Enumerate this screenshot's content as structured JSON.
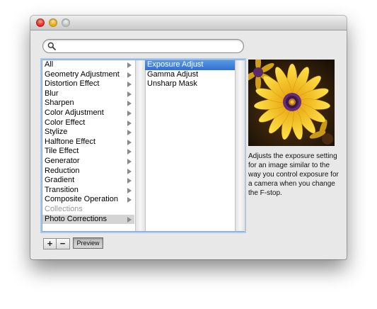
{
  "search": {
    "placeholder": "",
    "value": ""
  },
  "categories": [
    {
      "label": "All",
      "has_children": true
    },
    {
      "label": "Geometry Adjustment",
      "has_children": true
    },
    {
      "label": "Distortion Effect",
      "has_children": true
    },
    {
      "label": "Blur",
      "has_children": true
    },
    {
      "label": "Sharpen",
      "has_children": true
    },
    {
      "label": "Color Adjustment",
      "has_children": true
    },
    {
      "label": "Color Effect",
      "has_children": true
    },
    {
      "label": "Stylize",
      "has_children": true
    },
    {
      "label": "Halftone Effect",
      "has_children": true
    },
    {
      "label": "Tile Effect",
      "has_children": true
    },
    {
      "label": "Generator",
      "has_children": true
    },
    {
      "label": "Reduction",
      "has_children": true
    },
    {
      "label": "Gradient",
      "has_children": true
    },
    {
      "label": "Transition",
      "has_children": true
    },
    {
      "label": "Composite Operation",
      "has_children": true
    },
    {
      "label": "Collections",
      "has_children": false,
      "disabled": true
    },
    {
      "label": "Photo Corrections",
      "has_children": true,
      "selected": true
    }
  ],
  "filters": [
    {
      "label": "Exposure Adjust",
      "selected": true
    },
    {
      "label": "Gamma Adjust"
    },
    {
      "label": "Unsharp Mask"
    }
  ],
  "description": "Adjusts the exposure setting for an image similar to the way you control exposure for a camera when you change the F-stop.",
  "buttons": {
    "add": "+",
    "remove": "−",
    "preview": "Preview"
  },
  "colors": {
    "selection_blue": "#3a7bd5",
    "focus_ring": "#a9c8ec",
    "flower_yellow": "#f3c21a"
  }
}
